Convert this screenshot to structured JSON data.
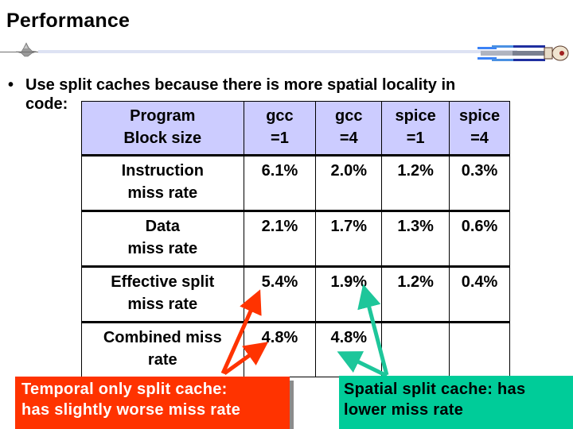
{
  "slide": {
    "title": "Performance",
    "bullet": {
      "marker": "•",
      "line1": "Use split caches because there is more spatial locality in",
      "line2": "code:"
    }
  },
  "table": {
    "header": {
      "label_line1": "Program",
      "label_line2": "Block size",
      "columns": [
        {
          "line1": "gcc",
          "line2": "=1"
        },
        {
          "line1": "gcc",
          "line2": "=4"
        },
        {
          "line1": "spice",
          "line2": "=1"
        },
        {
          "line1": "spice",
          "line2": "=4"
        }
      ]
    },
    "rows": [
      {
        "label_line1": "Instruction",
        "label_line2": "miss rate",
        "values": [
          "6.1%",
          "2.0%",
          "1.2%",
          "0.3%"
        ]
      },
      {
        "label_line1": "Data",
        "label_line2": "miss rate",
        "values": [
          "2.1%",
          "1.7%",
          "1.3%",
          "0.6%"
        ]
      },
      {
        "label_line1": "Effective split",
        "label_line2": "miss rate",
        "values": [
          "5.4%",
          "1.9%",
          "1.2%",
          "0.4%"
        ]
      },
      {
        "label_line1": "Combined miss",
        "label_line2": "rate",
        "values": [
          "4.8%",
          "4.8%",
          "",
          ""
        ]
      }
    ]
  },
  "callouts": {
    "temporal": {
      "line1": "Temporal only split cache:",
      "line2": "has slightly worse miss rate",
      "color": "#ff3300"
    },
    "spatial": {
      "line1": "Spatial split cache: has",
      "line2": "lower miss rate",
      "color": "#00cc99"
    }
  },
  "colors": {
    "header_fill": "#ccccff",
    "rule_bar": "#dde2f3"
  }
}
